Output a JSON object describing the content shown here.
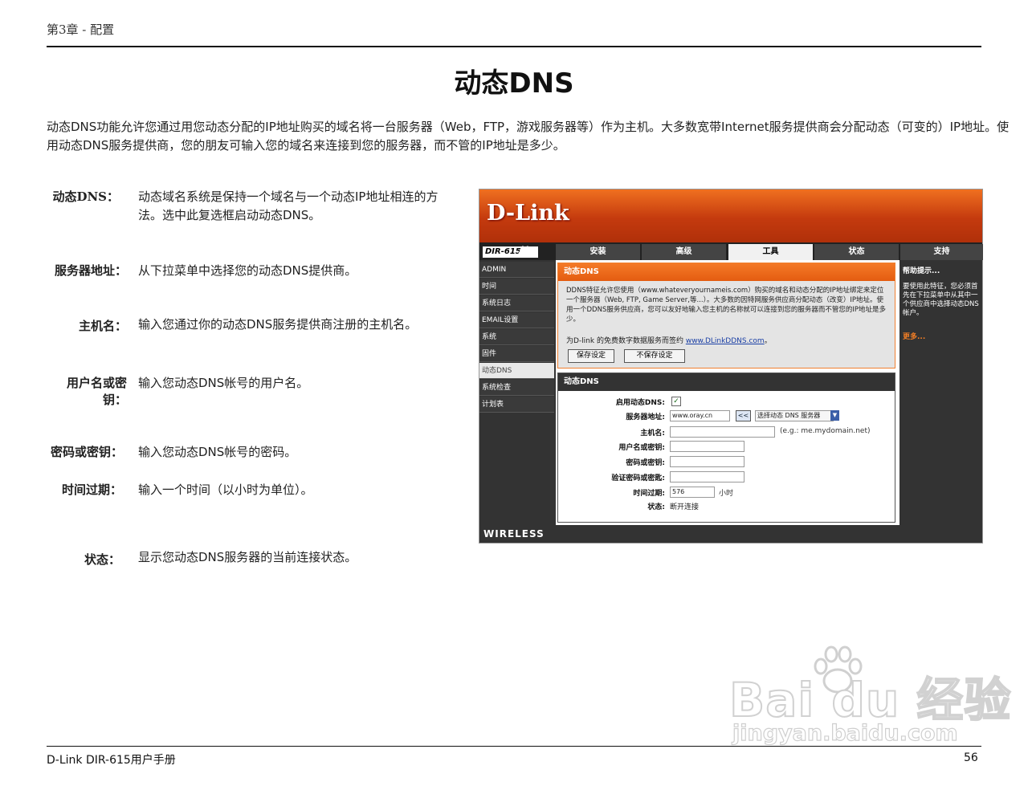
{
  "header": {
    "chapter": "第3章 - 配置"
  },
  "page_title": "动态DNS",
  "intro": "动态DNS功能允许您通过用您动态分配的IP地址购买的域名将一台服务器（Web，FTP，游戏服务器等）作为主机。大多数宽带Internet服务提供商会分配动态（可变的）IP地址。使用动态DNS服务提供商，您的朋友可输入您的域名来连接到您的服务器，而不管的IP地址是多少。",
  "fields": [
    {
      "label": "动态DNS：",
      "desc": "动态域名系统是保持一个域名与一个动态IP地址相连的方法。选中此复选框启动动态DNS。"
    },
    {
      "label": "服务器地址：",
      "desc": "从下拉菜单中选择您的动态DNS提供商。"
    },
    {
      "label": "主机名：",
      "desc": "输入您通过你的动态DNS服务提供商注册的主机名。"
    },
    {
      "label": "用户名或密钥：",
      "desc": "输入您动态DNS帐号的用户名。"
    },
    {
      "label": "密码或密钥：",
      "desc": "输入您动态DNS帐号的密码。"
    },
    {
      "label": "时间过期：",
      "desc": "输入一个时间（以小时为单位）。"
    },
    {
      "label": "状态：",
      "desc": "显示您动态DNS服务器的当前连接状态。"
    }
  ],
  "router": {
    "logo": "D-Link",
    "model": "DIR-615",
    "slashes": "//",
    "tabs": [
      "安装",
      "高级",
      "工具",
      "状态",
      "支持"
    ],
    "active_tab": "工具",
    "sidebar": [
      "ADMIN",
      "时间",
      "系统日志",
      "EMAIL设置",
      "系统",
      "固件",
      "动态DNS",
      "系统检查",
      "计划表"
    ],
    "active_sidebar": "动态DNS",
    "info_box": {
      "title": "动态DNS",
      "text": "DDNS特征允许您使用（www.whateveryournameis.com）购买的域名和动态分配的IP地址绑定来定位一个服务器（Web, FTP, Game Server,等...）。大多数的因特网服务供应商分配动态（改变）IP地址。使用一个DDNS服务供应商，您可以友好地输入您主机的名称就可以连接到您的服务器而不管您的IP地址是多少。",
      "link_prefix": "为D-link 的免费数字数据服务而签约 ",
      "link_text": "www.DLinkDDNS.com",
      "link_suffix": "。",
      "save_button": "保存设定",
      "nosave_button": "不保存设定"
    },
    "form": {
      "title": "动态DNS",
      "enable_label": "启用动态DNS:",
      "enable_checked": true,
      "server_label": "服务器地址:",
      "server_value": "www.oray.cn",
      "arrow_btn": "<<",
      "server_select": "选择动态 DNS 服务器",
      "host_label": "主机名:",
      "host_hint": "(e.g.: me.mydomain.net)",
      "user_label": "用户名或密钥:",
      "pass_label": "密码或密钥:",
      "verify_label": "验证密码或密匙:",
      "timeout_label": "时间过期:",
      "timeout_value": "576",
      "timeout_unit": "小时",
      "status_label": "状态:",
      "status_value": "断开连接"
    },
    "help": {
      "title": "帮助提示...",
      "text": "要使用此特征，您必须首先在下拉菜单中从其中一个供应商中选择动态DNS帐户。",
      "more": "更多..."
    },
    "footer": "WIRELESS"
  },
  "watermark": {
    "brand": "Bai du 经验",
    "url": "jingyan.baidu.com"
  },
  "footer": {
    "left": "D-Link DIR-615用户手册",
    "page_number": "56"
  },
  "colors": {
    "dlink_orange": "#e45c10",
    "dark_panel": "#333333",
    "link_blue": "#1a3fa5"
  }
}
